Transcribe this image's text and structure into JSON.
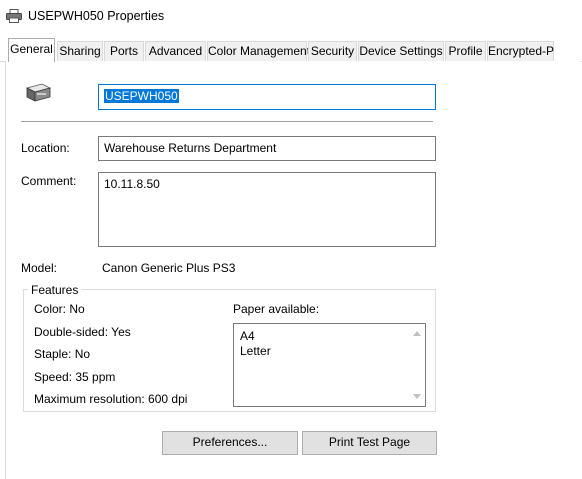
{
  "window": {
    "title": "USEPWH050 Properties"
  },
  "tabs": [
    {
      "label": "General",
      "active": true
    },
    {
      "label": "Sharing"
    },
    {
      "label": "Ports"
    },
    {
      "label": "Advanced"
    },
    {
      "label": "Color Management"
    },
    {
      "label": "Security"
    },
    {
      "label": "Device Settings"
    },
    {
      "label": "Profile"
    },
    {
      "label": "Encrypted-P"
    }
  ],
  "general": {
    "printer_name": "USEPWH050",
    "location_label": "Location:",
    "location_value": "Warehouse Returns Department",
    "comment_label": "Comment:",
    "comment_value": "10.11.8.50",
    "model_label": "Model:",
    "model_value": "Canon Generic Plus PS3",
    "features": {
      "legend": "Features",
      "color": "Color: No",
      "double_sided": "Double-sided: Yes",
      "staple": "Staple: No",
      "speed": "Speed: 35 ppm",
      "max_resolution": "Maximum resolution: 600 dpi",
      "paper_label": "Paper available:",
      "paper_sizes": [
        "A4",
        "Letter"
      ]
    },
    "preferences_button": "Preferences...",
    "print_test_page_button": "Print Test Page"
  }
}
